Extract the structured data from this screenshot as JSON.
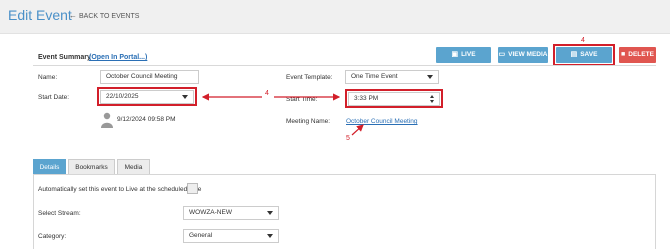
{
  "header": {
    "title": "Edit Event",
    "back_label": "BACK TO EVENTS"
  },
  "summary": {
    "label": "Event Summary",
    "portal_link": "(Open In Portal...)"
  },
  "toolbar": {
    "live_label": "LIVE MEETING",
    "media_label": "VIEW MEDIA",
    "save_label": "SAVE",
    "delete_label": "DELETE",
    "icons": {
      "live": "broadcast-icon",
      "media": "monitor-icon",
      "save": "floppy-disk-icon",
      "delete": "trash-icon"
    }
  },
  "form": {
    "name_label": "Name:",
    "name_value": "October Council Meeting",
    "start_date_label": "Start Date:",
    "start_date_value": "22/10/2025",
    "template_label": "Event Template:",
    "template_value": "One Time Event",
    "start_time_label": "Start Time:",
    "start_time_value": "3:33 PM",
    "meeting_name_label": "Meeting Name:",
    "meeting_name_value": "October Council Meeting",
    "modified_text": "9/12/2024 09:58 PM"
  },
  "annotations": {
    "save_step": "4",
    "date_time_step": "4",
    "meeting_name_step": "5"
  },
  "tabs": [
    {
      "label": "Details",
      "active": true
    },
    {
      "label": "Bookmarks",
      "active": false
    },
    {
      "label": "Media",
      "active": false
    }
  ],
  "details": {
    "auto_live_label": "Automatically set this event to Live at the scheduled time",
    "stream_label": "Select Stream:",
    "stream_value": "WOWZA-NEW",
    "category_label": "Category:",
    "category_value": "General"
  },
  "colors": {
    "accent": "#5ba4cf",
    "delete": "#e05650",
    "annotation": "#d21f2a",
    "title": "#4a90c8"
  }
}
